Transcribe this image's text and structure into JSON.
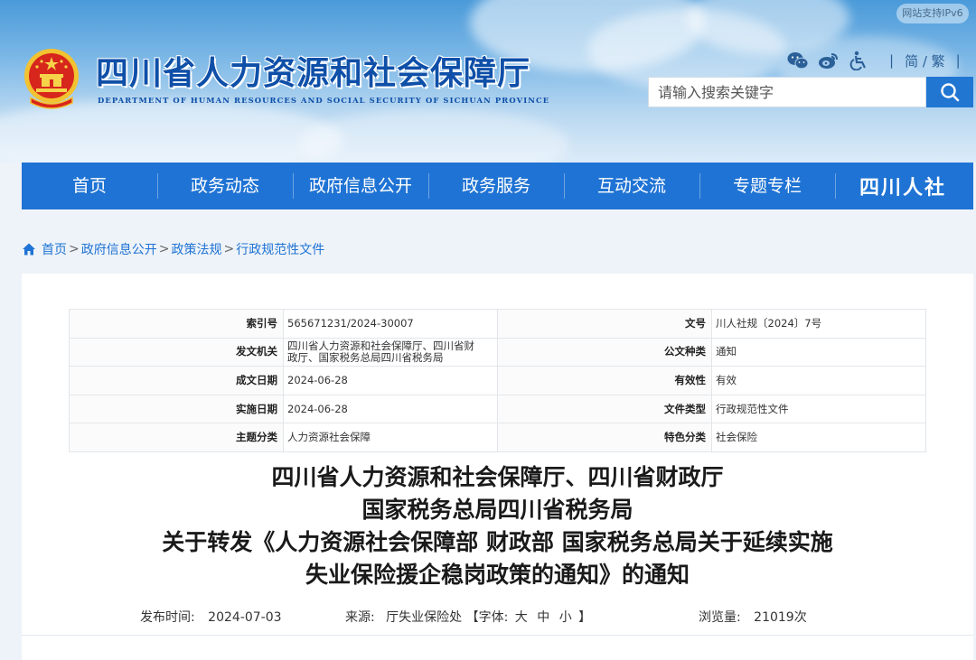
{
  "header": {
    "title": "四川省人力资源和社会保障厅",
    "subtitle": "DEPARTMENT OF HUMAN RESOURCES AND SOCIAL SECURITY OF SICHUAN PROVINCE",
    "ipv6_badge": "网站支持IPv6",
    "icons": [
      "wechat-icon",
      "weibo-icon",
      "accessibility-icon"
    ],
    "sep1": "|",
    "lang_toggle": "简 / 繁",
    "sep2": "|",
    "search": {
      "placeholder": "请输入搜索关键字"
    }
  },
  "nav": {
    "items": [
      "首页",
      "政务动态",
      "政府信息公开",
      "政务服务",
      "互动交流",
      "专题专栏"
    ],
    "brand": "四川人社"
  },
  "breadcrumb": {
    "items": [
      "首页",
      "政府信息公开",
      "政策法规",
      "行政规范性文件"
    ],
    "separator": ">"
  },
  "meta": {
    "rows": [
      {
        "k1": "索引号",
        "v1": "565671231/2024-30007",
        "k2": "文号",
        "v2": "川人社规〔2024〕7号"
      },
      {
        "k1": "发文机关",
        "v1a": "四川省人力资源和社会保障厅、四川省财",
        "v1b": "政厅、国家税务总局四川省税务局",
        "k2": "公文种类",
        "v2": "通知"
      },
      {
        "k1": "成文日期",
        "v1": "2024-06-28",
        "k2": "有效性",
        "v2": "有效"
      },
      {
        "k1": "实施日期",
        "v1": "2024-06-28",
        "k2": "文件类型",
        "v2": "行政规范性文件"
      },
      {
        "k1": "主题分类",
        "v1": "人力资源社会保障",
        "k2": "特色分类",
        "v2": "社会保险"
      }
    ]
  },
  "article": {
    "title_lines": [
      "四川省人力资源和社会保障厅、四川省财政厅",
      "国家税务总局四川省税务局",
      "关于转发《人力资源社会保障部 财政部 国家税务总局关于延续实施",
      "失业保险援企稳岗政策的通知》的通知"
    ],
    "publish_label": "发布时间:",
    "publish_date": "2024-07-03",
    "source_label": "来源:",
    "source": "厅失业保险处",
    "font_label": "【字体:",
    "font_large": "大",
    "font_medium": "中",
    "font_small": "小",
    "font_close": "】",
    "views_label": "浏览量:",
    "views": "21019次"
  },
  "colors": {
    "nav_bg": "#1f73d4",
    "title_blue": "#0e4fa8",
    "link_blue": "#1f73d4"
  }
}
